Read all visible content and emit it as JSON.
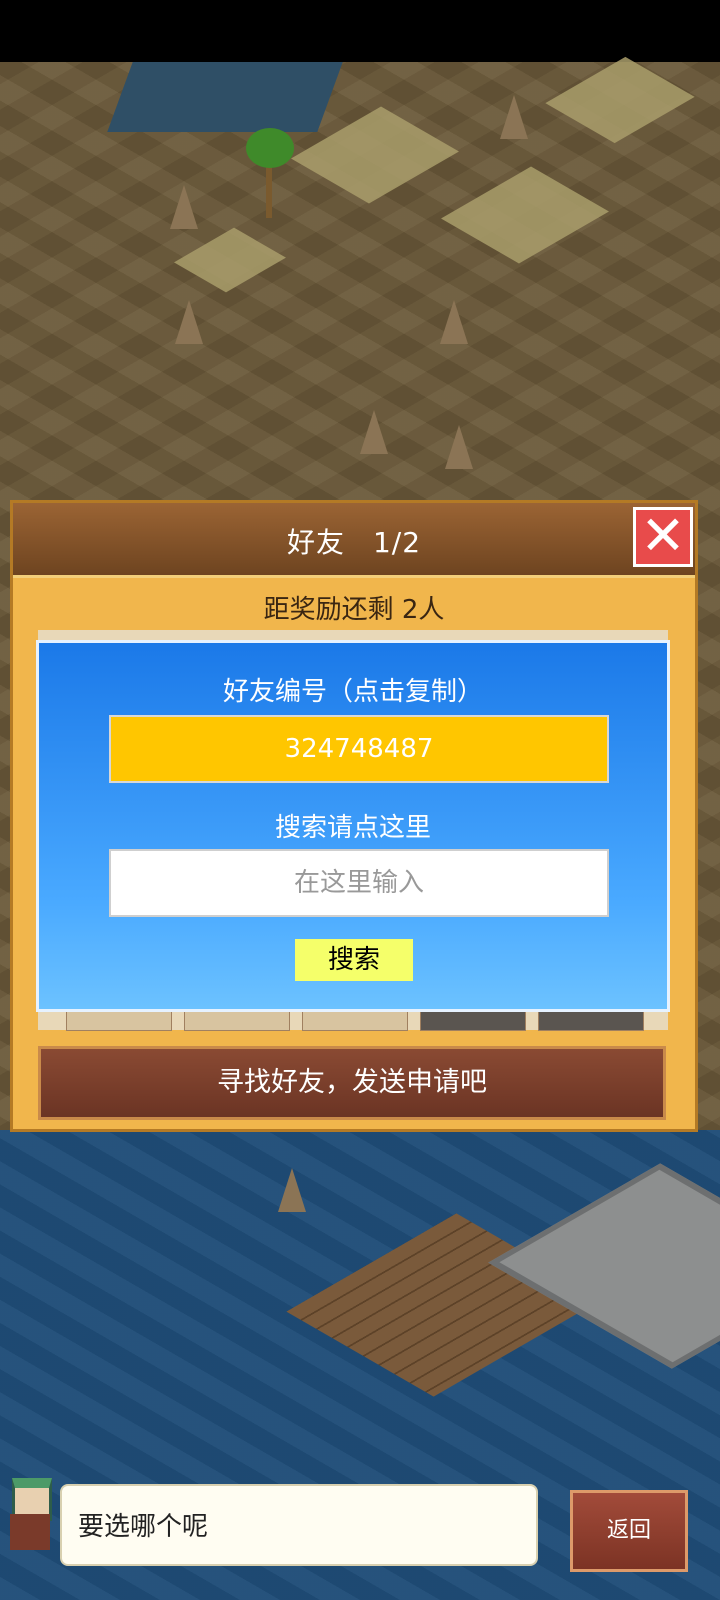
{
  "dialog": {
    "title": "好友",
    "page": "1/2",
    "reward_text": "距奖励还剩 2人"
  },
  "friend_panel": {
    "id_label": "好友编号（点击复制）",
    "friend_id": "324748487",
    "search_label": "搜索请点这里",
    "search_placeholder": "在这里输入",
    "search_button": "搜索"
  },
  "send_request_button": "寻找好友，发送申请吧",
  "speech": "要选哪个呢",
  "back_button": "返回",
  "icons": {
    "close": "close-icon",
    "prev": "chevron-left-icon",
    "next": "chevron-right-icon"
  },
  "colors": {
    "id_box": "#ffc600",
    "panel_top": "#1b79e8",
    "panel_bottom": "#6cc2ff",
    "close": "#e84b4b"
  }
}
